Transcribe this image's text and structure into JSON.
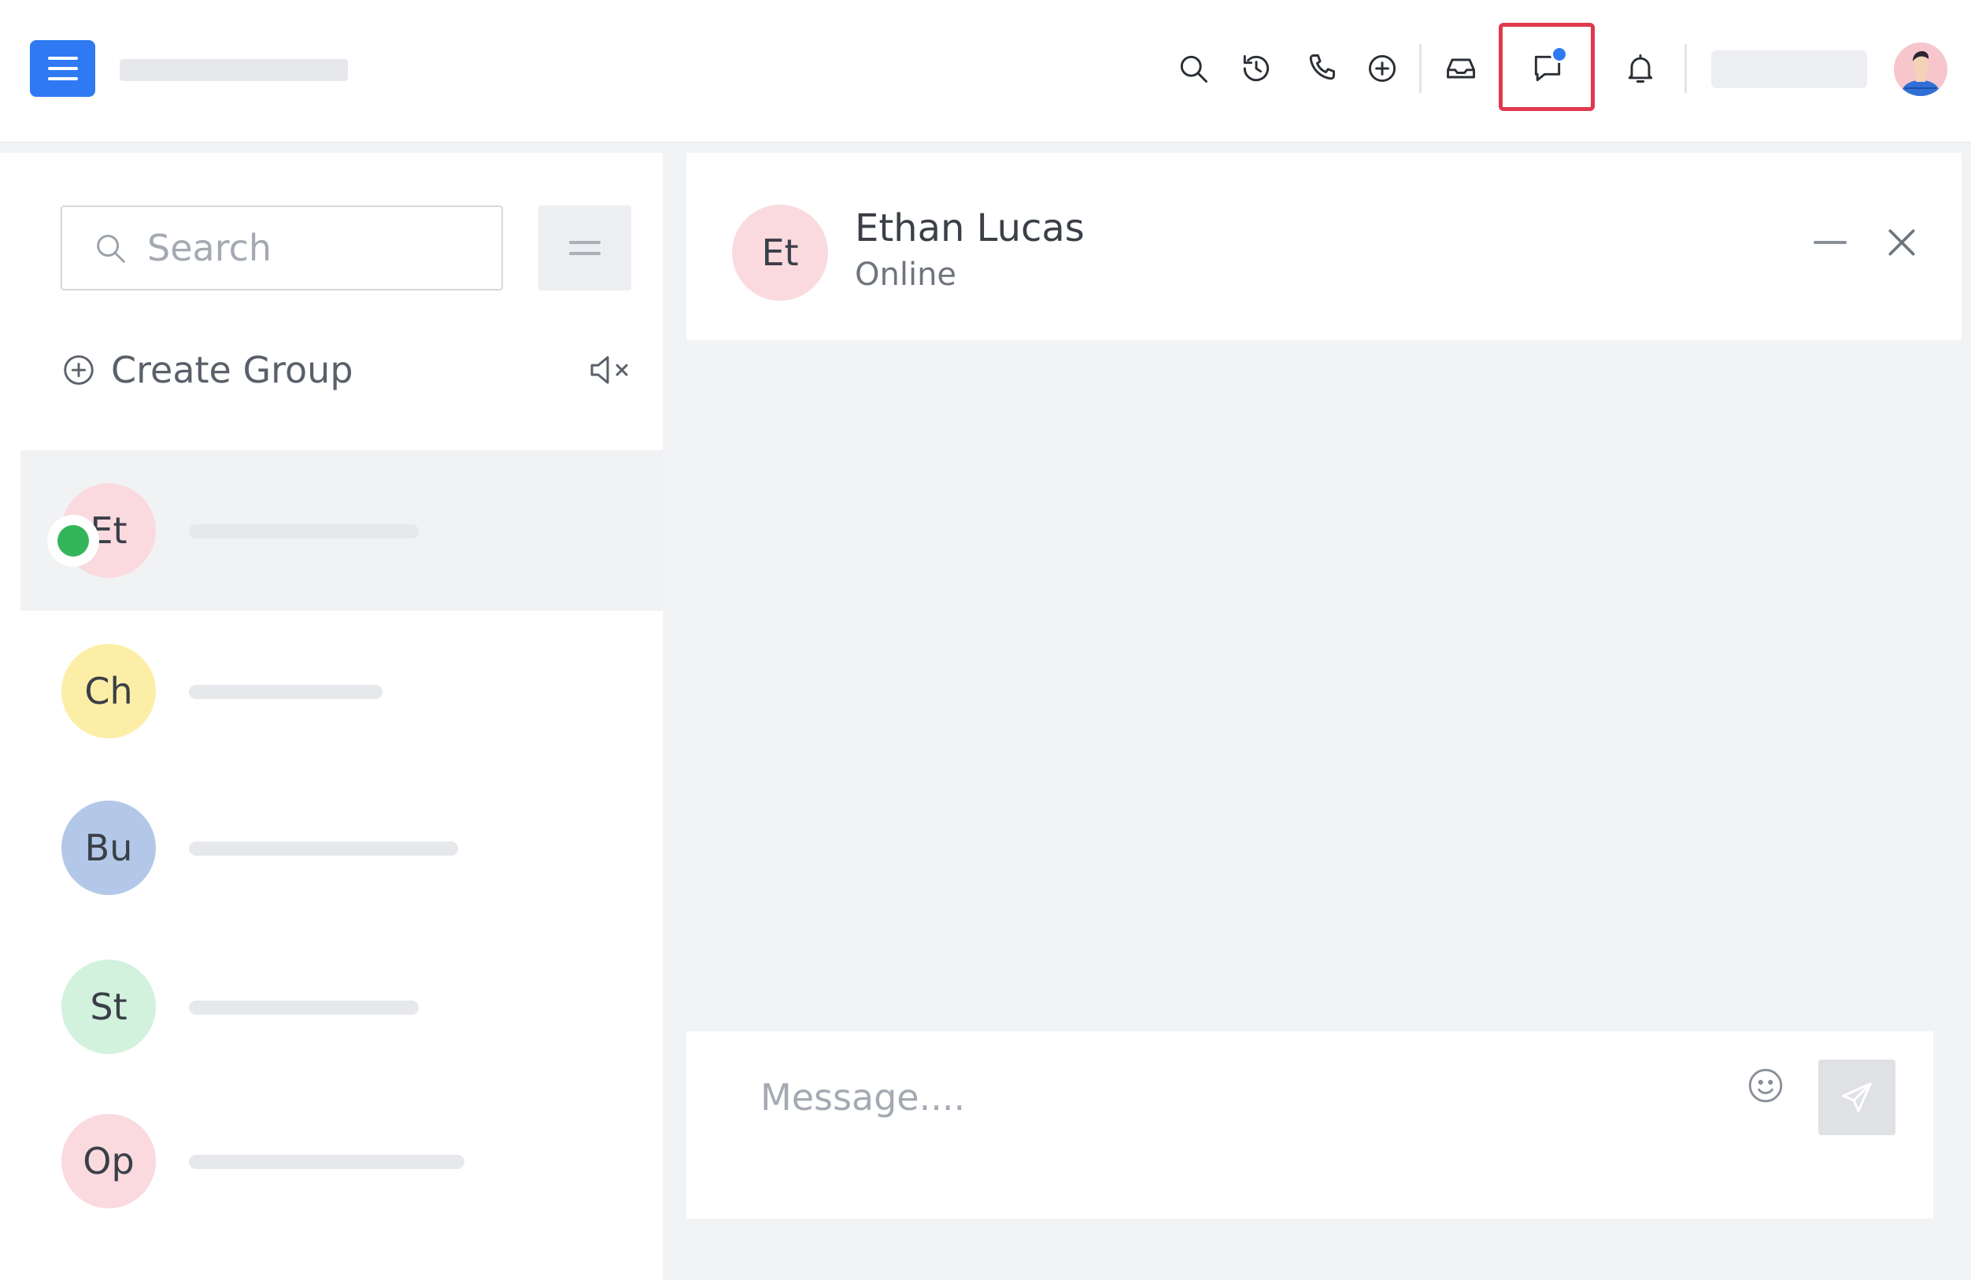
{
  "topbar": {
    "menu_icon": "hamburger-menu-icon",
    "icons": [
      "search-icon",
      "history-icon",
      "phone-icon",
      "add-circle-icon",
      "inbox-icon",
      "chat-icon",
      "bell-icon"
    ],
    "highlight_color": "#e0394e",
    "accent_color": "#2f7af3",
    "chat_has_unread": true
  },
  "sidebar": {
    "search_placeholder": "Search",
    "create_group_label": "Create Group",
    "contacts": [
      {
        "initials": "Et",
        "color": "#fadadf",
        "online": true,
        "active": true
      },
      {
        "initials": "Ch",
        "color": "#fdeea7",
        "online": false,
        "active": false
      },
      {
        "initials": "Bu",
        "color": "#b3c8e8",
        "online": false,
        "active": false
      },
      {
        "initials": "St",
        "color": "#d2f2de",
        "online": false,
        "active": false
      },
      {
        "initials": "Op",
        "color": "#fadadf",
        "online": false,
        "active": false
      }
    ]
  },
  "chat": {
    "initials": "Et",
    "name": "Ethan Lucas",
    "status": "Online",
    "message_placeholder": "Message...."
  }
}
